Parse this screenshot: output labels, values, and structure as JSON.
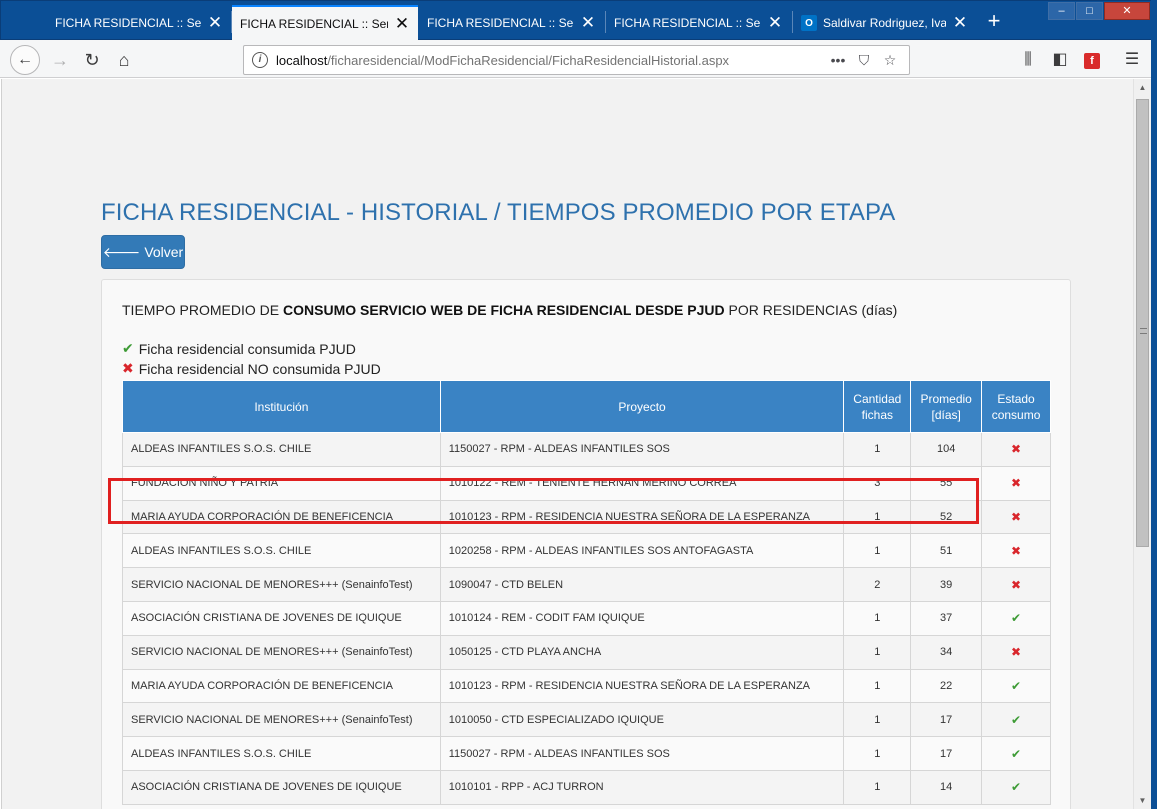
{
  "browser": {
    "tabs": [
      {
        "title": "FICHA RESIDENCIAL :: Senainfo",
        "active": false
      },
      {
        "title": "FICHA RESIDENCIAL :: Senainfo",
        "active": true
      },
      {
        "title": "FICHA RESIDENCIAL :: Senainfo",
        "active": false
      },
      {
        "title": "FICHA RESIDENCIAL :: Senainfo",
        "active": false
      },
      {
        "title": "Saldivar Rodriguez, Ivan",
        "active": false,
        "icon": "outlook-icon"
      }
    ],
    "new_tab_label": "+",
    "window_buttons": {
      "minimize": "–",
      "maximize": "□",
      "close": "✕"
    },
    "url_host": "localhost",
    "url_path": "/ficharesidencial/ModFichaResidencial/FichaResidencialHistorial.aspx",
    "icons": [
      "back-icon",
      "forward-icon",
      "reload-icon",
      "home-icon",
      "info-icon",
      "more-icon",
      "pocket-icon",
      "bookmark-star-icon",
      "library-icon",
      "sidebar-icon",
      "flash-icon",
      "menu-icon"
    ]
  },
  "page": {
    "title": "FICHA RESIDENCIAL - HISTORIAL / TIEMPOS PROMEDIO POR ETAPA",
    "back_button": "Volver",
    "heading_prefix": "TIEMPO PROMEDIO DE ",
    "heading_bold": "CONSUMO SERVICIO WEB DE FICHA RESIDENCIAL DESDE PJUD",
    "heading_suffix": " POR RESIDENCIAS (días)",
    "legend": {
      "consumed": "Ficha residencial consumida PJUD",
      "not_consumed": "Ficha residencial NO consumida PJUD"
    },
    "table": {
      "headers": {
        "institucion": "Institución",
        "proyecto": "Proyecto",
        "cantidad_1": "Cantidad",
        "cantidad_2": "fichas",
        "promedio_1": "Promedio",
        "promedio_2": "[días]",
        "estado_1": "Estado",
        "estado_2": "consumo"
      },
      "rows": [
        {
          "institucion": "ALDEAS INFANTILES S.O.S. CHILE",
          "proyecto": "1150027 - RPM - ALDEAS INFANTILES SOS",
          "cantidad": "1",
          "promedio": "104",
          "estado": "✖"
        },
        {
          "institucion": "FUNDACION NIÑO Y PATRIA",
          "proyecto": "1010122 - REM - TENIENTE HERNAN MERINO CORREA",
          "cantidad": "3",
          "promedio": "55",
          "estado": "✖"
        },
        {
          "institucion": "MARIA AYUDA CORPORACIÓN DE BENEFICENCIA",
          "proyecto": "1010123 - RPM - RESIDENCIA NUESTRA SEÑORA DE LA ESPERANZA",
          "cantidad": "1",
          "promedio": "52",
          "estado": "✖"
        },
        {
          "institucion": "ALDEAS INFANTILES S.O.S. CHILE",
          "proyecto": "1020258 - RPM - ALDEAS INFANTILES SOS ANTOFAGASTA",
          "cantidad": "1",
          "promedio": "51",
          "estado": "✖"
        },
        {
          "institucion": "SERVICIO NACIONAL DE MENORES+++ (SenainfoTest)",
          "proyecto": "1090047 - CTD BELEN",
          "cantidad": "2",
          "promedio": "39",
          "estado": "✖"
        },
        {
          "institucion": "ASOCIACIÓN CRISTIANA DE JOVENES DE IQUIQUE",
          "proyecto": "1010124 - REM - CODIT FAM IQUIQUE",
          "cantidad": "1",
          "promedio": "37",
          "estado": "✔"
        },
        {
          "institucion": "SERVICIO NACIONAL DE MENORES+++ (SenainfoTest)",
          "proyecto": "1050125 - CTD PLAYA ANCHA",
          "cantidad": "1",
          "promedio": "34",
          "estado": "✖"
        },
        {
          "institucion": "MARIA AYUDA CORPORACIÓN DE BENEFICENCIA",
          "proyecto": "1010123 - RPM - RESIDENCIA NUESTRA SEÑORA DE LA ESPERANZA",
          "cantidad": "1",
          "promedio": "22",
          "estado": "✔"
        },
        {
          "institucion": "SERVICIO NACIONAL DE MENORES+++ (SenainfoTest)",
          "proyecto": "1010050 - CTD ESPECIALIZADO IQUIQUE",
          "cantidad": "1",
          "promedio": "17",
          "estado": "✔"
        },
        {
          "institucion": "ALDEAS INFANTILES S.O.S. CHILE",
          "proyecto": "1150027 - RPM - ALDEAS INFANTILES SOS",
          "cantidad": "1",
          "promedio": "17",
          "estado": "✔"
        },
        {
          "institucion": "ASOCIACIÓN CRISTIANA DE JOVENES DE IQUIQUE",
          "proyecto": "1010101 - RPP - ACJ TURRON",
          "cantidad": "1",
          "promedio": "14",
          "estado": "✔"
        }
      ]
    },
    "colors": {
      "title_blue": "#2e71ad",
      "button_blue": "#337ab7",
      "header_blue": "#3a83c4",
      "check_green": "#3d9b35",
      "cross_red": "#d9262c",
      "highlight_red": "#e02020"
    }
  }
}
